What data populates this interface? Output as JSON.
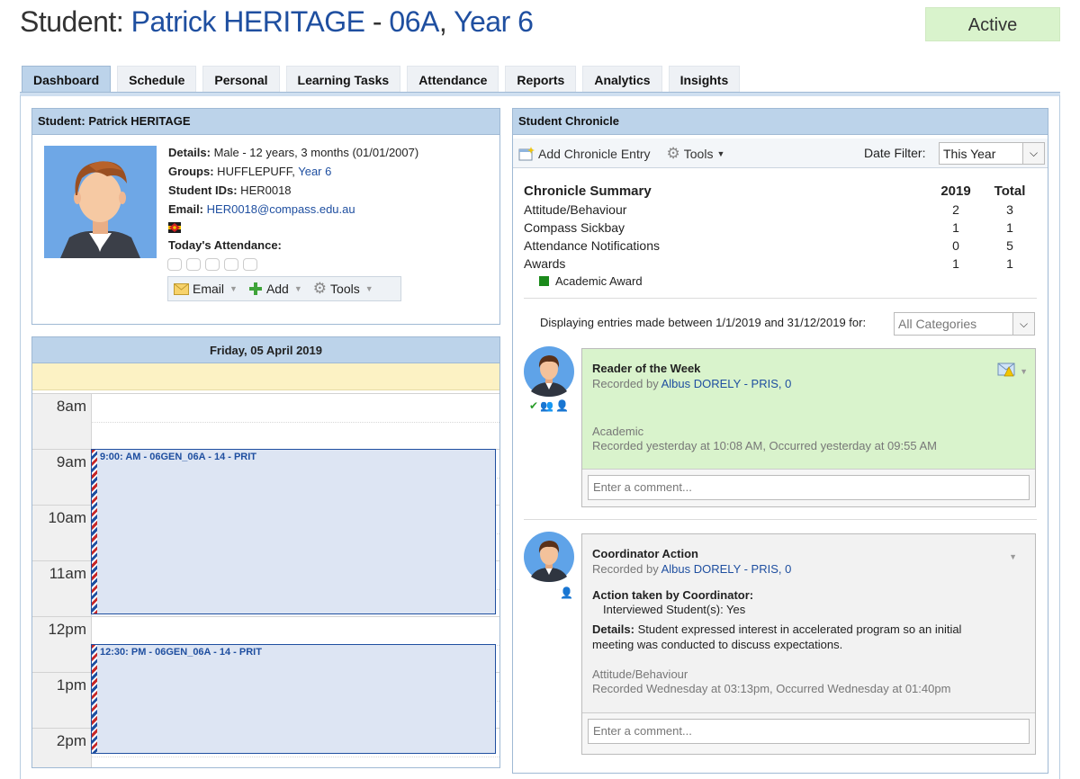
{
  "header": {
    "prefix": "Student: ",
    "student_name": "Patrick HERITAGE",
    "separator": " - ",
    "form": "06A",
    "comma": ", ",
    "year": "Year 6",
    "status": "Active",
    "status_color": "#d9f3cc"
  },
  "tabs": [
    {
      "label": "Dashboard",
      "active": true
    },
    {
      "label": "Schedule"
    },
    {
      "label": "Personal"
    },
    {
      "label": "Learning Tasks"
    },
    {
      "label": "Attendance"
    },
    {
      "label": "Reports"
    },
    {
      "label": "Analytics"
    },
    {
      "label": "Insights"
    }
  ],
  "student_panel": {
    "title": "Student: Patrick HERITAGE",
    "details_label": "Details:",
    "details_value": " Male - 12 years, 3 months (01/01/2007)",
    "groups_label": "Groups:",
    "groups_value": " HUFFLEPUFF, ",
    "groups_link": "Year 6",
    "ids_label": "Student IDs:",
    "ids_value": " HER0018",
    "email_label": "Email:",
    "email_value": "HER0018@compass.edu.au",
    "attendance_label": "Today's Attendance:",
    "toolbar": {
      "email": "Email",
      "add": "Add",
      "tools": "Tools"
    }
  },
  "calendar": {
    "date": "Friday, 05 April 2019",
    "hours": [
      "8am",
      "9am",
      "10am",
      "11am",
      "12pm",
      "1pm",
      "2pm"
    ],
    "events": [
      {
        "title": "9:00: AM - 06GEN_06A - 14 - PRIT",
        "start": "9:00",
        "end": "12:00"
      },
      {
        "title": "12:30: PM - 06GEN_06A - 14 - PRIT",
        "start": "12:30",
        "end": "14:30"
      }
    ]
  },
  "chronicle": {
    "title": "Student Chronicle",
    "add_entry": "Add Chronicle Entry",
    "tools": "Tools",
    "date_filter_label": "Date Filter:",
    "date_filter_value": "This Year",
    "summary": {
      "heading": "Chronicle Summary",
      "col1": "2019",
      "col2": "Total",
      "rows": [
        {
          "label": "Attitude/Behaviour",
          "y2019": "2",
          "total": "3"
        },
        {
          "label": "Compass Sickbay",
          "y2019": "1",
          "total": "1"
        },
        {
          "label": "Attendance Notifications",
          "y2019": "0",
          "total": "5"
        },
        {
          "label": "Awards",
          "y2019": "1",
          "total": "1"
        }
      ],
      "award_item": "Academic Award"
    },
    "display_range": "Displaying entries made between 1/1/2019 and 31/12/2019 for:",
    "category_filter": "All Categories",
    "entries": [
      {
        "title": "Reader of the Week",
        "recorded_by_prefix": "Recorded by ",
        "recorded_by": "Albus DORELY - PRIS, 0",
        "category": "Academic",
        "recorded": "Recorded yesterday at 10:08 AM, Occurred yesterday at 09:55 AM",
        "comment_placeholder": "Enter a comment...",
        "bg": "#d9f3cc"
      },
      {
        "title": "Coordinator Action",
        "recorded_by_prefix": "Recorded by ",
        "recorded_by": "Albus DORELY - PRIS, 0",
        "action_label": "Action taken by Coordinator:",
        "action_value": "Interviewed Student(s): Yes",
        "details_label": "Details:",
        "details_value": " Student expressed interest in accelerated program so an initial meeting was conducted to discuss expectations.",
        "category": "Attitude/Behaviour",
        "recorded": "Recorded Wednesday at 03:13pm, Occurred Wednesday at 01:40pm",
        "comment_placeholder": "Enter a comment...",
        "bg": "#f2f2f2"
      }
    ]
  }
}
